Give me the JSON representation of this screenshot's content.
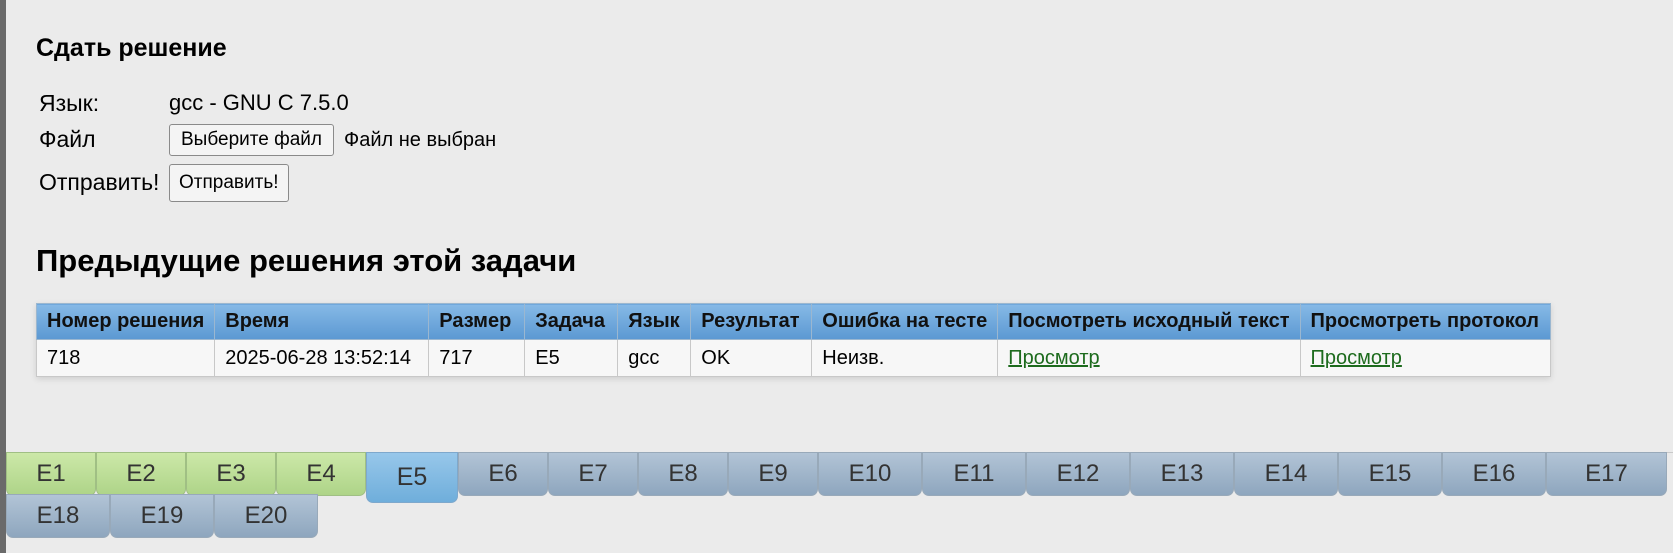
{
  "submit": {
    "heading": "Сдать решение",
    "language_label": "Язык:",
    "language_value": "gcc - GNU C 7.5.0",
    "file_label": "Файл",
    "file_button": "Выберите файл",
    "file_status": "Файл не выбран",
    "send_label": "Отправить!",
    "send_button": "Отправить!"
  },
  "previous": {
    "heading": "Предыдущие решения этой задачи",
    "columns": [
      "Номер решения",
      "Время",
      "Размер",
      "Задача",
      "Язык",
      "Результат",
      "Ошибка на тесте",
      "Посмотреть исходный текст",
      "Просмотреть протокол"
    ],
    "rows": [
      {
        "id": "718",
        "time": "2025-06-28 13:52:14",
        "size": "717",
        "problem": "E5",
        "lang": "gcc",
        "result": "OK",
        "failed_test": "Неизв.",
        "source_link": "Просмотр",
        "protocol_link": "Просмотр"
      }
    ]
  },
  "tabs": {
    "items": [
      {
        "label": "E1",
        "state": "solved"
      },
      {
        "label": "E2",
        "state": "solved"
      },
      {
        "label": "E3",
        "state": "solved"
      },
      {
        "label": "E4",
        "state": "solved"
      },
      {
        "label": "E5",
        "state": "active"
      },
      {
        "label": "E6",
        "state": "normal"
      },
      {
        "label": "E7",
        "state": "normal"
      },
      {
        "label": "E8",
        "state": "normal"
      },
      {
        "label": "E9",
        "state": "normal"
      },
      {
        "label": "E10",
        "state": "normal"
      },
      {
        "label": "E11",
        "state": "normal"
      },
      {
        "label": "E12",
        "state": "normal"
      },
      {
        "label": "E13",
        "state": "normal"
      },
      {
        "label": "E14",
        "state": "normal"
      },
      {
        "label": "E15",
        "state": "normal"
      },
      {
        "label": "E16",
        "state": "normal"
      },
      {
        "label": "E17",
        "state": "normal"
      },
      {
        "label": "E18",
        "state": "normal"
      },
      {
        "label": "E19",
        "state": "normal"
      },
      {
        "label": "E20",
        "state": "normal"
      }
    ],
    "colors": {
      "solved": "#b9dc95",
      "active": "#7fb8e0",
      "normal": "#9fb4ca"
    }
  }
}
